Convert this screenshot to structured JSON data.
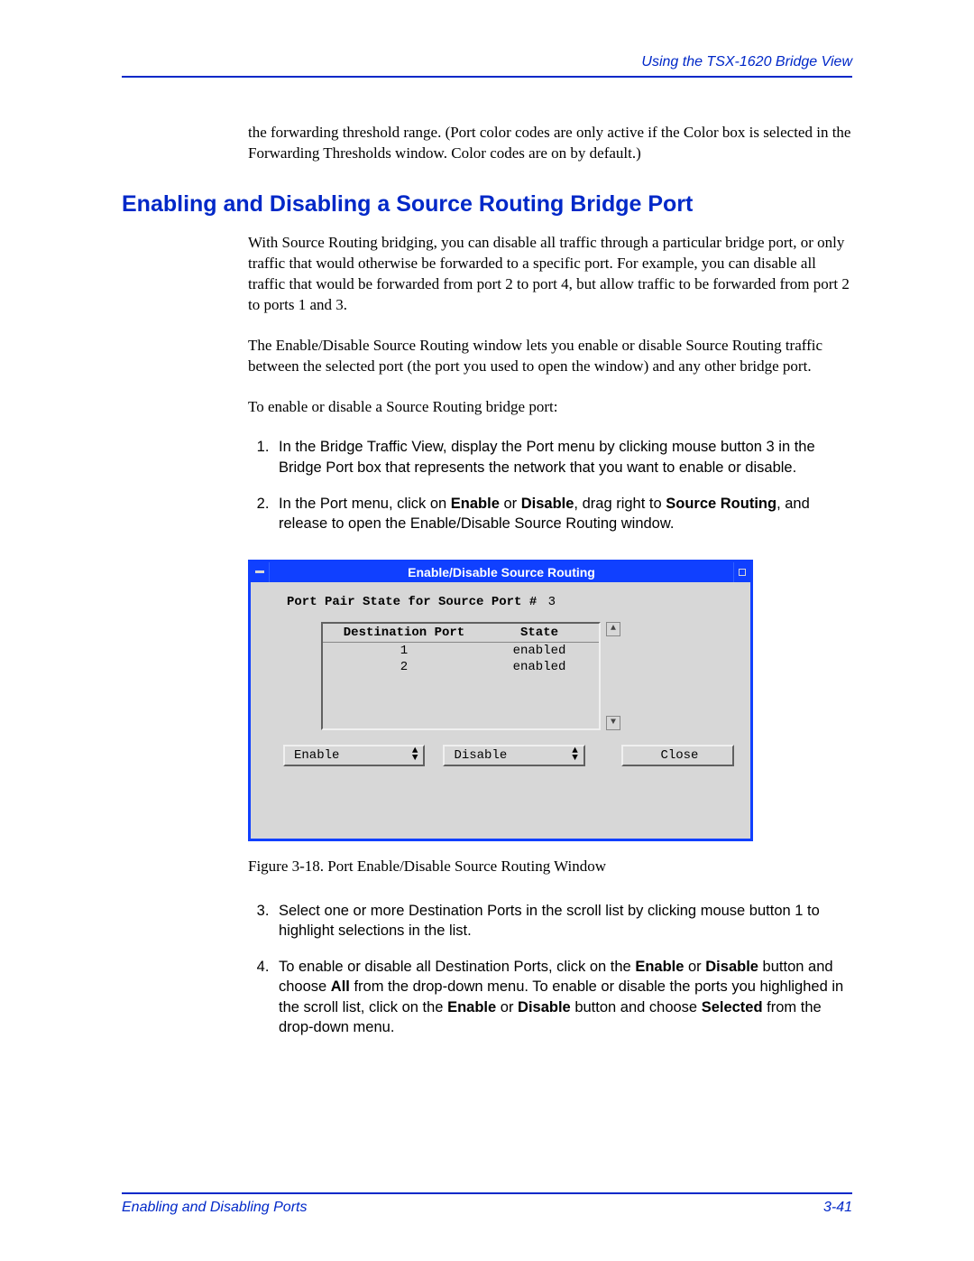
{
  "header": {
    "right": "Using the TSX-1620 Bridge View"
  },
  "intro_para": "the forwarding threshold range. (Port color codes are only active if the Color box is selected in the Forwarding Thresholds window. Color codes are on by default.)",
  "section_title": "Enabling and Disabling a Source Routing Bridge Port",
  "body_p1": "With Source Routing bridging, you can disable all traffic through a particular bridge port, or only traffic that would otherwise be forwarded to a specific port. For example, you can disable all traffic that would be forwarded from port 2 to port 4, but allow traffic to be forwarded from port 2 to ports 1 and 3.",
  "body_p2": "The Enable/Disable Source Routing window lets you enable or disable Source Routing traffic between the selected port (the port you used to open the window) and any other bridge port.",
  "body_p3": "To enable or disable a Source Routing bridge port:",
  "steps_a": {
    "s1": "In the Bridge Traffic View, display the Port menu by clicking mouse button 3 in the Bridge Port box that represents the network that you want to enable or disable.",
    "s2_pre": "In the Port menu, click on ",
    "s2_b1": "Enable",
    "s2_mid1": " or ",
    "s2_b2": "Disable",
    "s2_mid2": ", drag right to ",
    "s2_b3": "Source Routing",
    "s2_post": ", and release to open the Enable/Disable Source Routing window."
  },
  "figure": {
    "window_title": "Enable/Disable Source Routing",
    "port_pair_label": "Port Pair State for Source Port #",
    "port_pair_num": "3",
    "col_dest": "Destination Port",
    "col_state": "State",
    "rows": {
      "r0": {
        "port": "1",
        "state": "enabled"
      },
      "r1": {
        "port": "2",
        "state": "enabled"
      }
    },
    "btn_enable": "Enable",
    "btn_disable": "Disable",
    "btn_close": "Close",
    "caption": "Figure 3-18. Port Enable/Disable Source Routing Window"
  },
  "steps_b": {
    "s3": "Select one or more Destination Ports in the scroll list by clicking mouse button 1 to highlight selections in the list.",
    "s4_pre": "To enable or disable all Destination Ports, click on the ",
    "s4_b1": "Enable",
    "s4_mid1": " or ",
    "s4_b2": "Disable",
    "s4_mid2": " button and choose ",
    "s4_b3": "All",
    "s4_mid3": " from the drop-down menu. To enable or disable the ports you highlighed in the scroll list, click on the ",
    "s4_b4": "Enable",
    "s4_mid4": " or ",
    "s4_b5": "Disable",
    "s4_mid5": " button and choose ",
    "s4_b6": "Selected",
    "s4_post": " from the drop-down menu."
  },
  "footer": {
    "left": "Enabling and Disabling Ports",
    "right": "3-41"
  }
}
